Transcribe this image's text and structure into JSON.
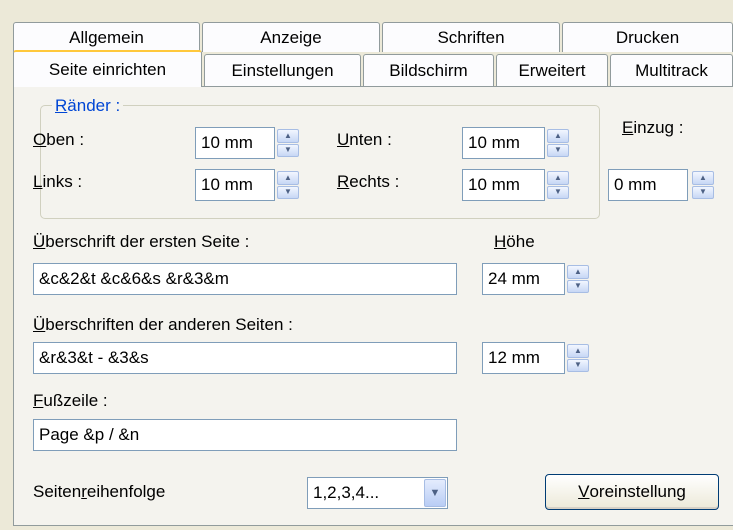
{
  "tabs_row1": [
    "Allgemein",
    "Anzeige",
    "Schriften",
    "Drucken"
  ],
  "tabs_row2": [
    "Seite einrichten",
    "Einstellungen",
    "Bildschirm",
    "Erweitert",
    "Multitrack"
  ],
  "active_tab": "Seite einrichten",
  "margins": {
    "legend": {
      "mnemonic": "R",
      "rest": "änder :"
    },
    "top": {
      "mnemonic": "O",
      "rest": "ben :",
      "value": "10 mm"
    },
    "bottom": {
      "mnemonic": "U",
      "rest": "nten :",
      "value": "10 mm"
    },
    "left": {
      "mnemonic": "L",
      "rest": "inks :",
      "value": "10 mm"
    },
    "right": {
      "mnemonic": "R",
      "rest": "echts :",
      "value": "10 mm"
    }
  },
  "indent": {
    "mnemonic": "E",
    "rest": "inzug :",
    "value": "0 mm"
  },
  "height_label": {
    "mnemonic": "H",
    "rest": "öhe"
  },
  "first_page_header": {
    "mnemonic": "Ü",
    "rest": "berschrift der ersten Seite :",
    "value": "&c&2&t &c&6&s &r&3&m",
    "height": "24 mm"
  },
  "other_pages_header": {
    "mnemonic": "Ü",
    "rest": "berschriften der anderen Seiten :",
    "value": "&r&3&t - &3&s",
    "height": "12 mm"
  },
  "footer": {
    "mnemonic": "F",
    "rest": "ußzeile :",
    "value": "Page &p / &n"
  },
  "page_order": {
    "prefix": "Seiten",
    "mnemonic": "r",
    "rest": "eihenfolge",
    "value": "1,2,3,4..."
  },
  "default_button": {
    "mnemonic": "V",
    "rest": "oreinstellung"
  }
}
